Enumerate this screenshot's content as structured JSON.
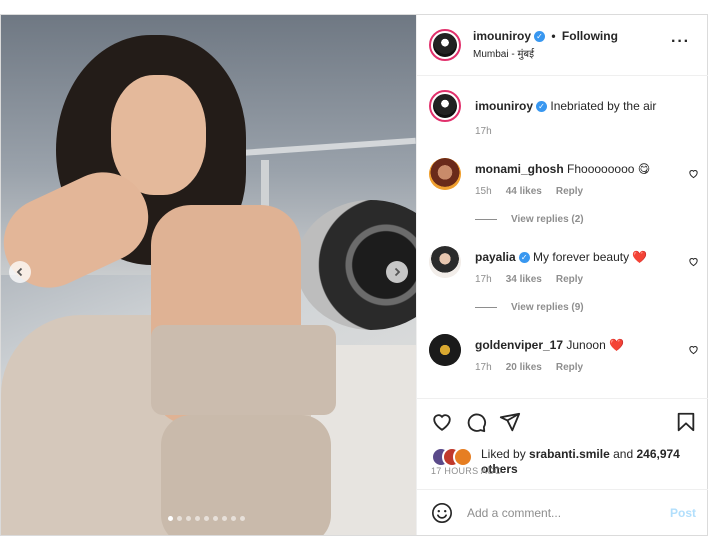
{
  "post": {
    "username": "imouniroy",
    "separator": "•",
    "follow_state": "Following",
    "location": "Mumbai - मुंबई",
    "more_icon": "more-horizontal-icon",
    "carousel": {
      "slide_count": 9,
      "active_slide": 1
    }
  },
  "caption": {
    "username": "imouniroy",
    "text": "Inebriated by the air",
    "time": "17h"
  },
  "comments": [
    {
      "username": "monami_ghosh",
      "verified": false,
      "text": "Fhoooooooo 😋",
      "time": "15h",
      "likes": "44 likes",
      "reply": "Reply",
      "view_replies": "View replies (2)"
    },
    {
      "username": "payalia",
      "verified": true,
      "text": "My forever beauty ❤️",
      "time": "17h",
      "likes": "34 likes",
      "reply": "Reply",
      "view_replies": "View replies (9)"
    },
    {
      "username": "goldenviper_17",
      "verified": false,
      "text": "Junoon ❤️",
      "time": "17h",
      "likes": "20 likes",
      "reply": "Reply"
    }
  ],
  "liked_by": {
    "prefix": "Liked by",
    "user": "srabanti.smile",
    "middle": "and",
    "count": "246,974",
    "suffix": "others"
  },
  "timestamp": "17 HOURS AGO",
  "add_comment": {
    "placeholder": "Add a comment...",
    "post_label": "Post",
    "emoji_icon": "smiley-icon"
  },
  "colors": {
    "verified": "#3897f0",
    "like_heart": "#ed4956",
    "post_disabled": "#b2dffc"
  }
}
